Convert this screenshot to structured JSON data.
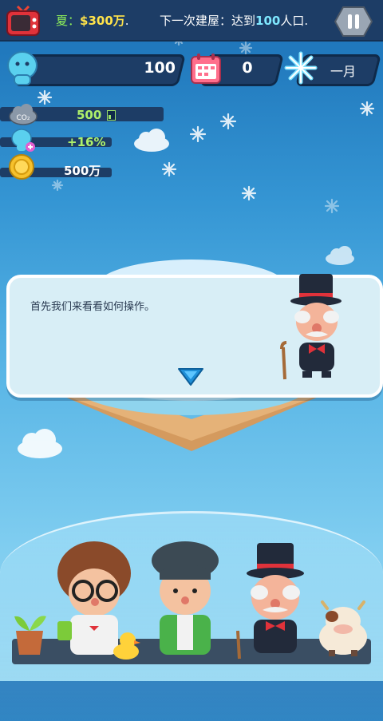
{
  "top_bar": {
    "season_label": "夏：",
    "season_money": "$300万",
    "season_suffix": ".",
    "goal_prefix": "下一次建屋：达到",
    "goal_value": "100",
    "goal_suffix": "人口."
  },
  "stats": {
    "population": "100",
    "calendar_count": "0",
    "month": "一月",
    "co2": "500",
    "happiness": "+16%",
    "money": "500万"
  },
  "dialog": {
    "text": "首先我们来看看如何操作。"
  },
  "colors": {
    "bar": "#1d3d66",
    "accent_green": "#8ff05a",
    "accent_yellow": "#ffe34a",
    "sky_top": "#1a6fb5",
    "sky_bottom": "#9ad8f2"
  },
  "icons": [
    "tv-icon",
    "pause-icon",
    "population-icon",
    "calendar-icon",
    "snowflake-icon",
    "co2-icon",
    "happiness-icon",
    "coin-icon",
    "next-arrow-icon"
  ]
}
